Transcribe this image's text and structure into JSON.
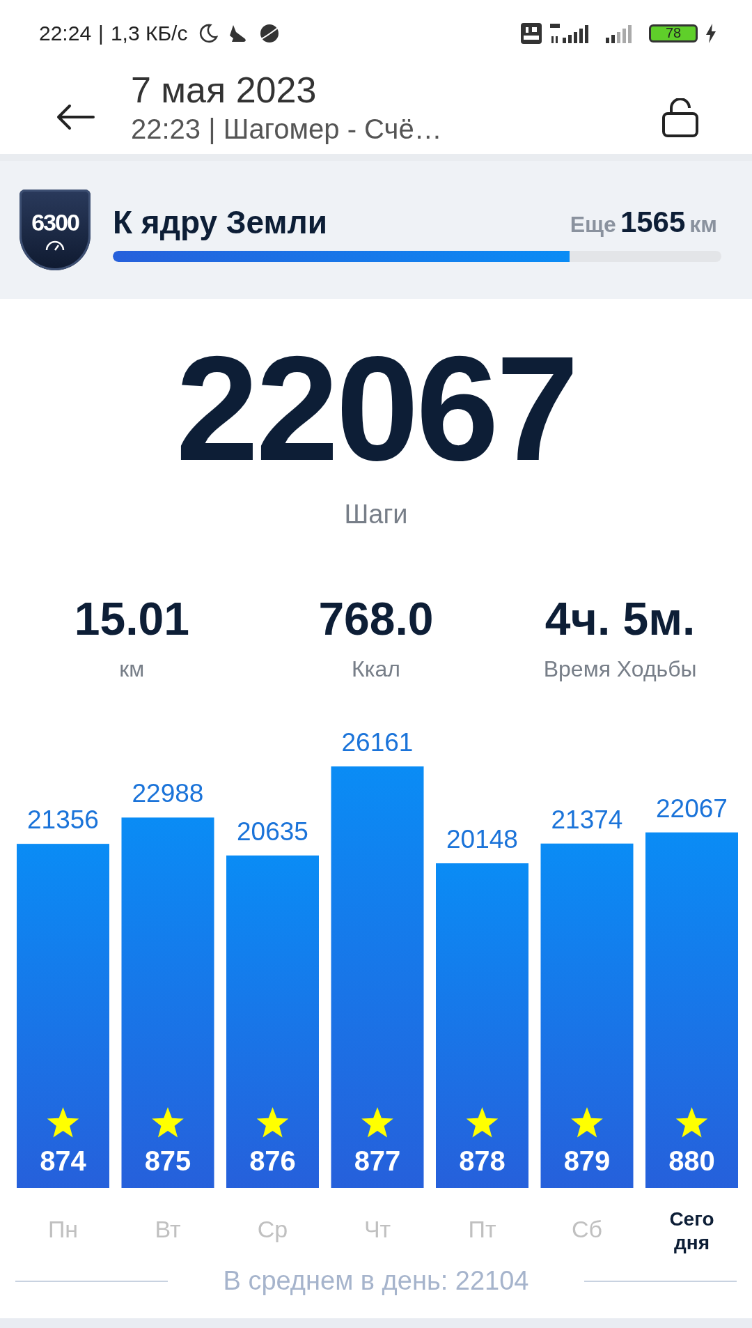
{
  "status_bar": {
    "time": "22:24",
    "separator": "|",
    "speed": "1,3 КБ/с",
    "battery": "78"
  },
  "header": {
    "title": "7 мая 2023",
    "subtitle": "22:23 | Шагомер - Счё…"
  },
  "goal": {
    "badge": "6300",
    "title": "К ядру Земли",
    "remaining_prefix": "Еще",
    "remaining_value": "1565",
    "remaining_unit": "км",
    "level": 0.75
  },
  "steps": {
    "value": "22067",
    "label": "Шаги"
  },
  "stats": [
    {
      "value": "15.01",
      "label": "км"
    },
    {
      "value": "768.0",
      "label": "Ккал"
    },
    {
      "value": "4ч. 5м.",
      "label": "Время Ходьбы"
    }
  ],
  "chart_data": {
    "type": "bar",
    "categories": [
      "Пн",
      "Вт",
      "Ср",
      "Чт",
      "Пт",
      "Сб",
      "Сегодня"
    ],
    "values": [
      21356,
      22988,
      20635,
      26161,
      20148,
      21374,
      22067
    ],
    "data_labels": true
  },
  "days": [
    {
      "star_count": "874",
      "selected": false
    },
    {
      "star_count": "875",
      "selected": false
    },
    {
      "star_count": "876",
      "selected": false
    },
    {
      "star_count": "877",
      "selected": false
    },
    {
      "star_count": "878",
      "selected": false
    },
    {
      "star_count": "879",
      "selected": false
    },
    {
      "star_count": "880",
      "selected": true
    }
  ],
  "average": "В среднем в день: 22104"
}
